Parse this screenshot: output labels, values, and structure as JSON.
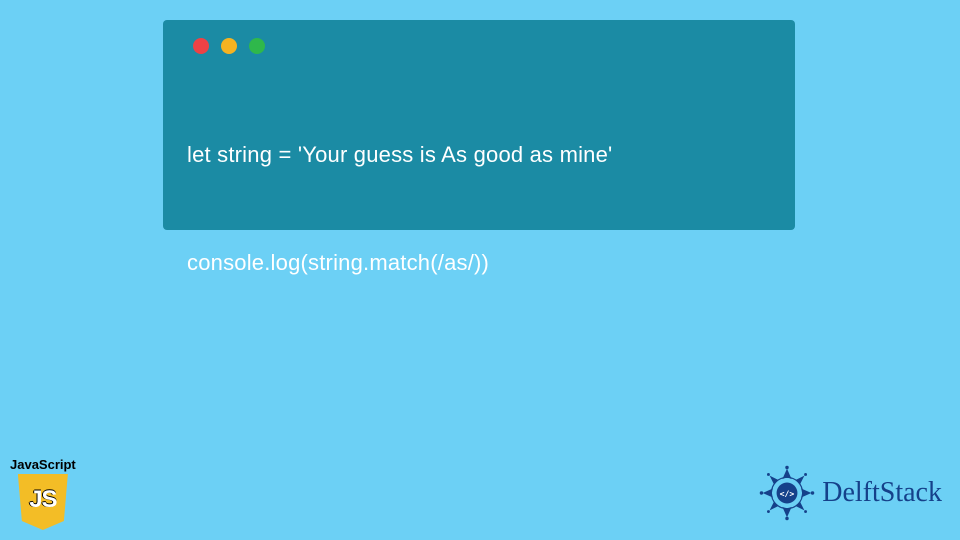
{
  "code": {
    "line1": "let string = 'Your guess is As good as mine'",
    "line2": "console.log(string.match(/as/))"
  },
  "traffic_lights": {
    "red": "#ed4245",
    "yellow": "#f5b321",
    "green": "#2fb84b"
  },
  "js_badge": {
    "label": "JavaScript",
    "glyph": "JS"
  },
  "brand": {
    "name": "DelftStack"
  },
  "colors": {
    "page_bg": "#6cd0f5",
    "window_bg": "#1b8ba4",
    "code_text": "#ffffff",
    "brand_text": "#15418a"
  }
}
